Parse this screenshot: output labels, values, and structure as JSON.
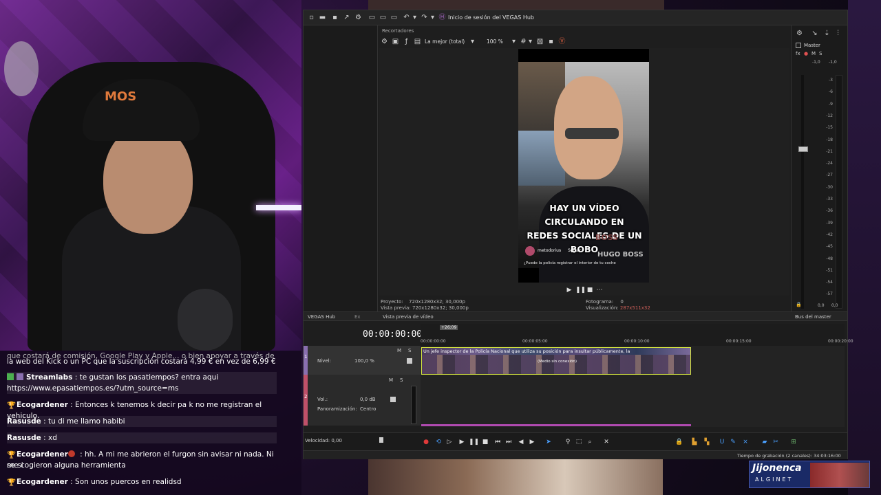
{
  "app": {
    "title": "Inicio de sesión del VEGAS Hub",
    "tab_recent": "Recortadores"
  },
  "preview": {
    "quality": "La mejor (total)",
    "zoom": "100 %",
    "caption_line1": "HAY UN VÍDEO CIRCULANDO EN",
    "caption_line2": "REDES SOCIALES DE UN BOBO",
    "brand1": "BOSS",
    "brand2": "HUGO BOSS",
    "username": "metodorius",
    "follow": "Seguir",
    "subtitle": "¿Puede la policía registrar el interior de tu coche",
    "project_label": "Proyecto:",
    "project_value": "720x1280x32; 30,000p",
    "preview_label": "Vista previa:",
    "preview_value": "720x1280x32; 30,000p",
    "frame_label": "Fotograma:",
    "frame_value": "0",
    "display_label": "Visualización:",
    "display_value": "287x511x32"
  },
  "master": {
    "title": "Master",
    "values_left": "-1,0",
    "values_right": "-1,0",
    "bottom_left": "0,0",
    "bottom_right": "0,0",
    "scale": [
      "3",
      "6",
      "9",
      "12",
      "15",
      "18",
      "21",
      "24",
      "27",
      "30",
      "33",
      "36",
      "39",
      "42",
      "45",
      "48",
      "51",
      "54",
      "57"
    ],
    "bus_label": "Bus del master"
  },
  "tabs": {
    "hub": "VEGAS Hub",
    "explorer": "Ex",
    "video_preview": "Vista previa de vídeo"
  },
  "timeline": {
    "timecode": "00:00:00:00",
    "ruler": [
      "00:00:00:00",
      "00:00:05:00",
      "00:00:10:00",
      "00:00:15:00",
      "00:00:20:00"
    ],
    "marker": "+26:09",
    "track1_num": "1",
    "track1_level_label": "Nivel:",
    "track1_level_value": "100,0 %",
    "track2_num": "2",
    "track2_vol_label": "Vol.:",
    "track2_vol_value": "0,0 dB",
    "track2_pan_label": "Panoramización:",
    "track2_pan_value": "Centro",
    "mute": "M",
    "solo": "S",
    "clip_title": "Un jefe inspector de la Policía Nacional que utiliza su posición para insultar públicamente, la",
    "clip_label": "(Medio sin conexión)",
    "speed_label": "Velocidad: 0,00",
    "record_time": "Tiempo de grabación (2 canales): 34:03:16:00"
  },
  "chat": [
    {
      "nick": "",
      "text": "que costará de comisión, Google Play y Apple... o bien apoyar a través de",
      "type": "cut"
    },
    {
      "nick": "",
      "text": "la web del Kick o un PC que la suscripción costará 4,99 € en vez de 6,99 €",
      "type": "plain"
    },
    {
      "nick": "Streamlabs",
      "text": " : te gustan los pasatiempos? entra aqui",
      "type": "bot"
    },
    {
      "nick": "",
      "text": "https://www.epasatiempos.es/?utm_source=ms",
      "type": "plain"
    },
    {
      "nick": "Ecogardener",
      "text": " : Entonces k tenemos k decir pa k no me registran el vehiculo.",
      "type": "user"
    },
    {
      "nick": "Rasusde",
      "text": " : tu di me llamo habibi",
      "type": "user2"
    },
    {
      "nick": "Rasusde",
      "text": " : xd",
      "type": "user2"
    },
    {
      "nick": "Ecogardener",
      "text": " : hh. A mi me abrieron el furgon sin avisar ni nada. Ni se si",
      "type": "user"
    },
    {
      "nick": "",
      "text": "me cogieron alguna herramienta",
      "type": "plain"
    },
    {
      "nick": "Ecogardener",
      "text": " : Son unos puercos en realidsd",
      "type": "user"
    }
  ],
  "sponsor": {
    "name": "Jijonenca",
    "sub": "ALGINET"
  },
  "cam": {
    "cap_logo": "MOS"
  },
  "colors": {
    "accent_purple": "#8a6fb0",
    "clip_border": "#d6e640",
    "record_red": "#e03a3a"
  }
}
